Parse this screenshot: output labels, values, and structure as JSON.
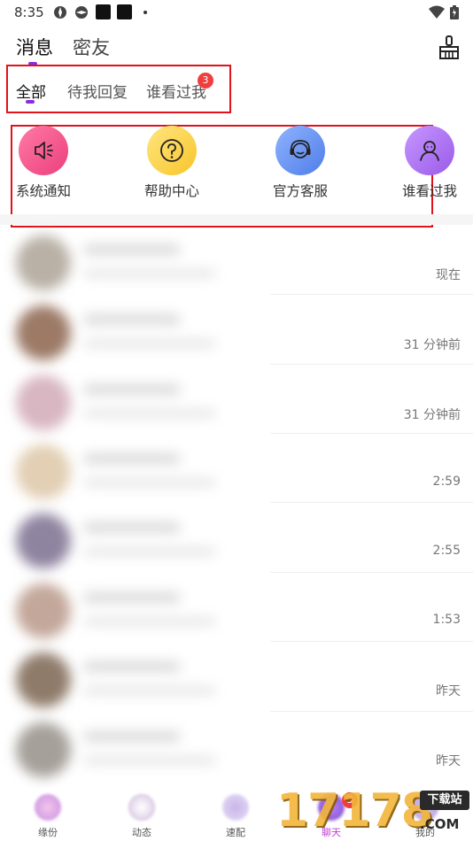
{
  "status_bar": {
    "time": "8:35"
  },
  "header": {
    "tabs": [
      {
        "label": "消息",
        "active": true
      },
      {
        "label": "密友",
        "active": false
      }
    ]
  },
  "sub_tabs": [
    {
      "label": "全部",
      "active": true
    },
    {
      "label": "待我回复",
      "active": false
    },
    {
      "label": "谁看过我",
      "active": false,
      "badge": "3"
    }
  ],
  "quick_entries": [
    {
      "label": "系统通知",
      "icon": "speaker-icon",
      "color": "#f15a8e"
    },
    {
      "label": "帮助中心",
      "icon": "question-icon",
      "color": "#fbd54a"
    },
    {
      "label": "官方客服",
      "icon": "headset-icon",
      "color": "#5f8ff0"
    },
    {
      "label": "谁看过我",
      "icon": "user-icon",
      "color": "#a66be6"
    }
  ],
  "chats": [
    {
      "time": "现在"
    },
    {
      "time": "31 分钟前"
    },
    {
      "time": "31 分钟前"
    },
    {
      "time": "2:59"
    },
    {
      "time": "2:55"
    },
    {
      "time": "1:53"
    },
    {
      "time": "昨天"
    },
    {
      "time": "昨天"
    }
  ],
  "bottom_nav": [
    {
      "label": "缘份",
      "active": false
    },
    {
      "label": "动态",
      "active": false
    },
    {
      "label": "速配",
      "active": false
    },
    {
      "label": "聊天",
      "active": true,
      "badge": "3"
    },
    {
      "label": "我的",
      "active": false
    }
  ],
  "watermark": {
    "text": "17178",
    "badge": "下载站",
    "domain": ".COM"
  },
  "colors": {
    "accent": "#8a2be2",
    "badge": "#f03e3e",
    "highlight_box": "#e0121a"
  }
}
